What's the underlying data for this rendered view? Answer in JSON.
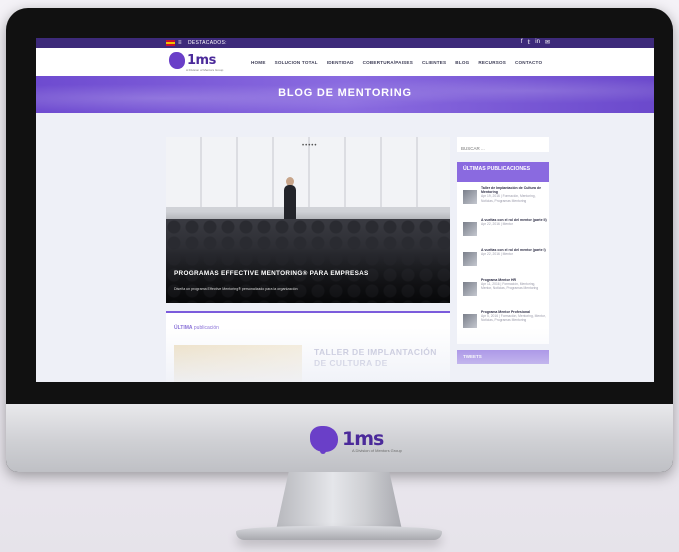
{
  "topbar": {
    "featured": "DESTACADOS:",
    "menu_glyph": "≡",
    "social": [
      "f",
      "𝕥",
      "in",
      "✉"
    ]
  },
  "brand": {
    "name": "1ms",
    "tagline": "A Division of Mentors Group"
  },
  "nav": {
    "items": [
      "HOME",
      "SOLUCION TOTAL",
      "IDENTIDAD",
      "COBERTURA/PAISES",
      "CLIENTES",
      "BLOG",
      "RECURSOS",
      "CONTACTO"
    ]
  },
  "hero": {
    "title": "BLOG DE MENTORING"
  },
  "featured_post": {
    "dots": "•••••",
    "title": "PROGRAMAS EFFECTIVE MENTORING® PARA EMPRESAS",
    "subtitle": "Diseña un programa Effective Mentoring® personalizado para la organización"
  },
  "latest": {
    "label_bold": "ÚLTIMA",
    "label_rest": "publicación",
    "post_title": "TALLER DE IMPLANTACIÓN DE CULTURA DE"
  },
  "sidebar": {
    "search_placeholder": "BUSCAR ...",
    "recent_title": "ÚLTIMAS PUBLICACIONES",
    "recent": [
      {
        "title": "Taller de Implantación de Cultura de Mentoring",
        "meta": "Apr 19, 2016 | Formación, Mentoring, Noticias, Programas Mentoring"
      },
      {
        "title": "A vueltas con el rol del mentor (parte II)",
        "meta": "Apr 22, 2016 | Mentor"
      },
      {
        "title": "A vueltas con el rol del mentor (parte I)",
        "meta": "Apr 22, 2016 | Mentor"
      },
      {
        "title": "Programa Mentor HR",
        "meta": "Apr 11, 2016 | Formación, Mentoring, Mentor, Noticias, Programas Mentoring"
      },
      {
        "title": "Programa Mentor Profesional",
        "meta": "Apr 5, 2016 | Formación, Mentoring, Mentor, Noticias, Programas Mentoring"
      }
    ],
    "tweets_title": "TWEETS"
  },
  "colors": {
    "accent": "#7b5bdc",
    "topbar": "#3d2a7a",
    "brand": "#4b2a9a"
  }
}
